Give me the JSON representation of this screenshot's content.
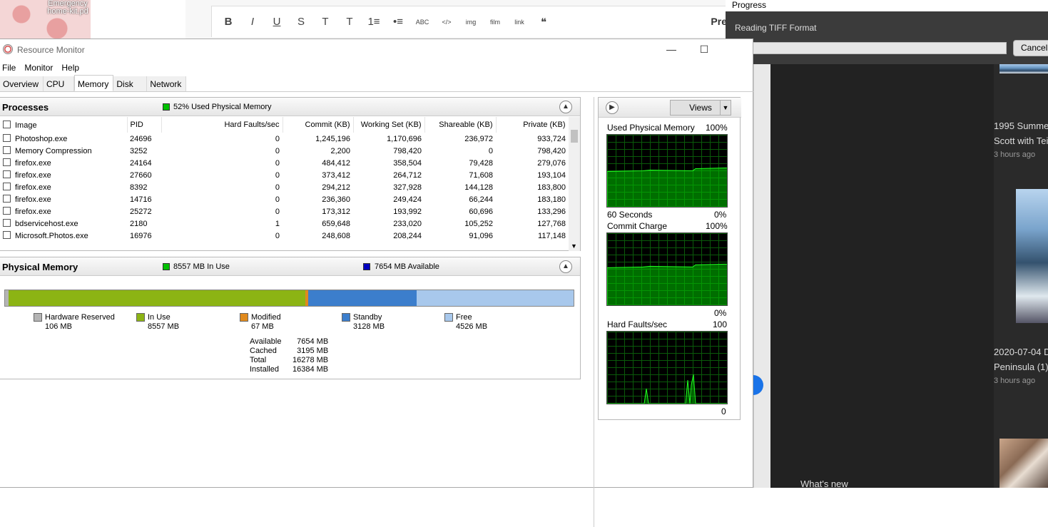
{
  "desktop": {
    "icon_label": "Emergency\nhome-kit.pd"
  },
  "editor": {
    "toolbar_icons": [
      "B",
      "I",
      "U",
      "S",
      "T",
      "T",
      "1≡",
      "•≡",
      "ABC",
      "</>",
      "img",
      "film",
      "link",
      "❝"
    ],
    "trailing_label": "Pre"
  },
  "progress": {
    "title": "Progress",
    "message": "Reading TIFF Format",
    "percent": 4,
    "cancel_label": "Cancel"
  },
  "feed": {
    "items": [
      {
        "title": "1995 Summer",
        "subtitle": "Scott with Tei",
        "time": "3 hours ago"
      },
      {
        "title": "2020-07-04 D",
        "subtitle": "Peninsula (1).",
        "time": "3 hours ago"
      }
    ],
    "footer": "What's new"
  },
  "window": {
    "title": "Resource Monitor",
    "minimize": "—",
    "maximize": "☐",
    "menu": [
      "File",
      "Monitor",
      "Help"
    ],
    "tabs": [
      "Overview",
      "CPU",
      "Memory",
      "Disk",
      "Network"
    ],
    "active_tab": "Memory"
  },
  "processes": {
    "title": "Processes",
    "summary": "52% Used Physical Memory",
    "summary_color": "#00c000",
    "columns": [
      "Image",
      "PID",
      "Hard Faults/sec",
      "Commit (KB)",
      "Working Set (KB)",
      "Shareable (KB)",
      "Private (KB)"
    ],
    "rows": [
      [
        "Photoshop.exe",
        "24696",
        "0",
        "1,245,196",
        "1,170,696",
        "236,972",
        "933,724"
      ],
      [
        "Memory Compression",
        "3252",
        "0",
        "2,200",
        "798,420",
        "0",
        "798,420"
      ],
      [
        "firefox.exe",
        "24164",
        "0",
        "484,412",
        "358,504",
        "79,428",
        "279,076"
      ],
      [
        "firefox.exe",
        "27660",
        "0",
        "373,412",
        "264,712",
        "71,608",
        "193,104"
      ],
      [
        "firefox.exe",
        "8392",
        "0",
        "294,212",
        "327,928",
        "144,128",
        "183,800"
      ],
      [
        "firefox.exe",
        "14716",
        "0",
        "236,360",
        "249,424",
        "66,244",
        "183,180"
      ],
      [
        "firefox.exe",
        "25272",
        "0",
        "173,312",
        "193,992",
        "60,696",
        "133,296"
      ],
      [
        "bdservicehost.exe",
        "2180",
        "1",
        "659,648",
        "233,020",
        "105,252",
        "127,768"
      ],
      [
        "Microsoft.Photos.exe",
        "16976",
        "0",
        "248,608",
        "208,244",
        "91,096",
        "117,148"
      ]
    ]
  },
  "physical_memory": {
    "title": "Physical Memory",
    "in_use_label": "8557 MB In Use",
    "available_label": "7654 MB Available",
    "in_use_color": "#00c000",
    "available_color": "#0000c0",
    "segments": [
      {
        "name": "Hardware Reserved",
        "value": "106 MB",
        "mb": 106,
        "color": "#b4b4b4"
      },
      {
        "name": "In Use",
        "value": "8557 MB",
        "mb": 8557,
        "color": "#8cb414"
      },
      {
        "name": "Modified",
        "value": "67 MB",
        "mb": 67,
        "color": "#e08a1e"
      },
      {
        "name": "Standby",
        "value": "3128 MB",
        "mb": 3128,
        "color": "#3c7ecc"
      },
      {
        "name": "Free",
        "value": "4526 MB",
        "mb": 4526,
        "color": "#a8c8ec"
      }
    ],
    "summary": [
      [
        "Available",
        "7654 MB"
      ],
      [
        "Cached",
        "3195 MB"
      ],
      [
        "Total",
        "16278 MB"
      ],
      [
        "Installed",
        "16384 MB"
      ]
    ]
  },
  "graphs": {
    "views_label": "Views",
    "used_physical": {
      "title": "Used Physical Memory",
      "max": "100%",
      "min": "0%",
      "footer": "60 Seconds",
      "level": 0.52
    },
    "commit_charge": {
      "title": "Commit Charge",
      "max": "100%",
      "min": "0%",
      "level": 0.55
    },
    "hard_faults": {
      "title": "Hard Faults/sec",
      "max": "100",
      "min": "0"
    }
  }
}
